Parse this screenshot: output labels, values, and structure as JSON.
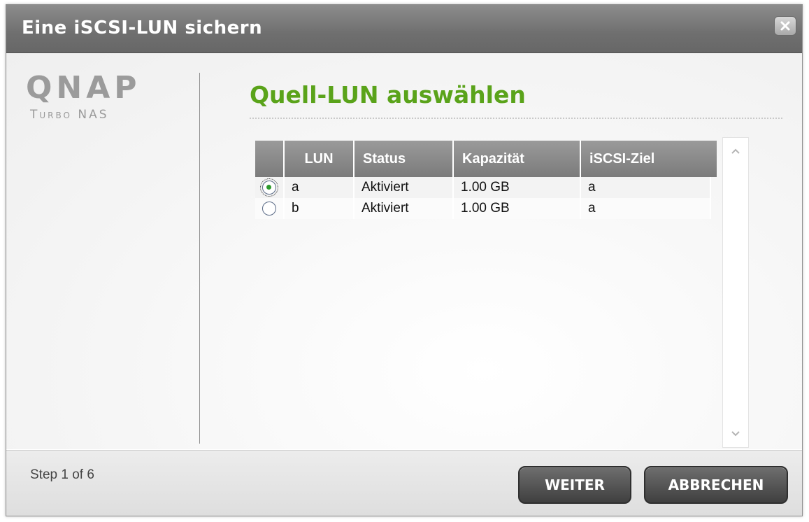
{
  "window": {
    "title": "Eine iSCSI-LUN sichern"
  },
  "logo": {
    "main": "QNAP",
    "sub": "Turbo NAS"
  },
  "page": {
    "heading": "Quell-LUN auswählen"
  },
  "table": {
    "columns": [
      "",
      "LUN",
      "Status",
      "Kapazität",
      "iSCSI-Ziel"
    ],
    "rows": [
      {
        "selected": true,
        "lun": "a",
        "status": "Aktiviert",
        "capacity": "1.00 GB",
        "target": "a"
      },
      {
        "selected": false,
        "lun": "b",
        "status": "Aktiviert",
        "capacity": "1.00 GB",
        "target": "a"
      }
    ]
  },
  "footer": {
    "step": "Step 1 of 6",
    "next_label": "WEITER",
    "cancel_label": "ABBRECHEN"
  },
  "colors": {
    "heading": "#5aa31a",
    "titlebar": "#6f6f6f",
    "radio_checked": "#2c9a2c"
  },
  "icons": {
    "close": "close-icon",
    "scroll_up": "chevron-up-icon",
    "scroll_down": "chevron-down-icon"
  }
}
